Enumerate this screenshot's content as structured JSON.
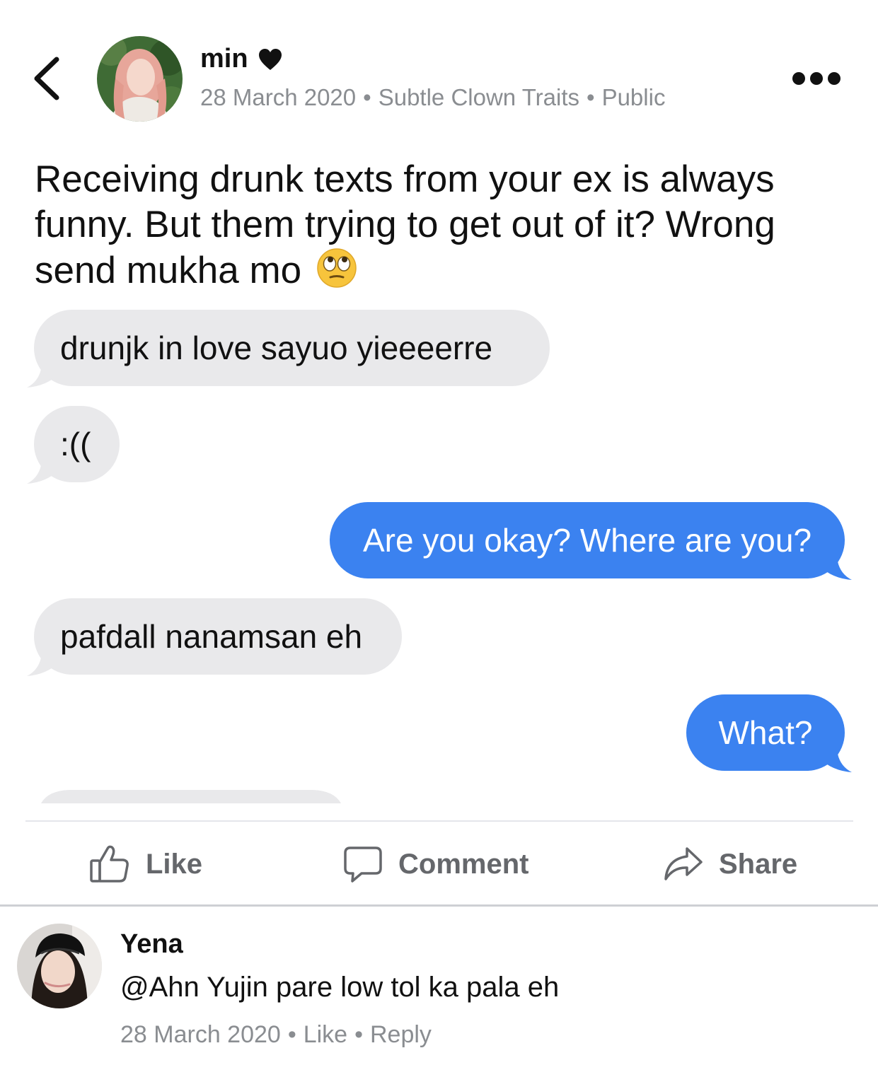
{
  "post": {
    "author_name": "min",
    "date": "28 March 2020",
    "group": "Subtle Clown Traits",
    "audience": "Public",
    "separator": "•",
    "text": "Receiving drunk texts from your ex is always funny. But them trying to get out of it? Wrong send mukha mo"
  },
  "messages": [
    {
      "direction": "incoming",
      "text": "drunjk in love sayuo yieeeerre"
    },
    {
      "direction": "incoming",
      "text": ":(("
    },
    {
      "direction": "outgoing",
      "text": "Are you okay? Where are you?"
    },
    {
      "direction": "incoming",
      "text": "pafdall nanamsan eh"
    },
    {
      "direction": "outgoing",
      "text": "What?"
    }
  ],
  "actions": {
    "like": "Like",
    "comment": "Comment",
    "share": "Share"
  },
  "comment": {
    "author": "Yena",
    "text": "@Ahn Yujin pare low tol ka pala eh",
    "date": "28 March 2020",
    "like": "Like",
    "reply": "Reply",
    "separator": "•"
  },
  "colors": {
    "outgoing_bubble": "#3b82f0",
    "incoming_bubble": "#e9e9eb",
    "meta_text": "#8a8d91",
    "action_text": "#65676b"
  },
  "icons": [
    "back-chevron-icon",
    "heart-icon",
    "more-icon",
    "eyeroll-emoji-icon",
    "thumbs-up-icon",
    "comment-bubble-icon",
    "share-arrow-icon"
  ]
}
